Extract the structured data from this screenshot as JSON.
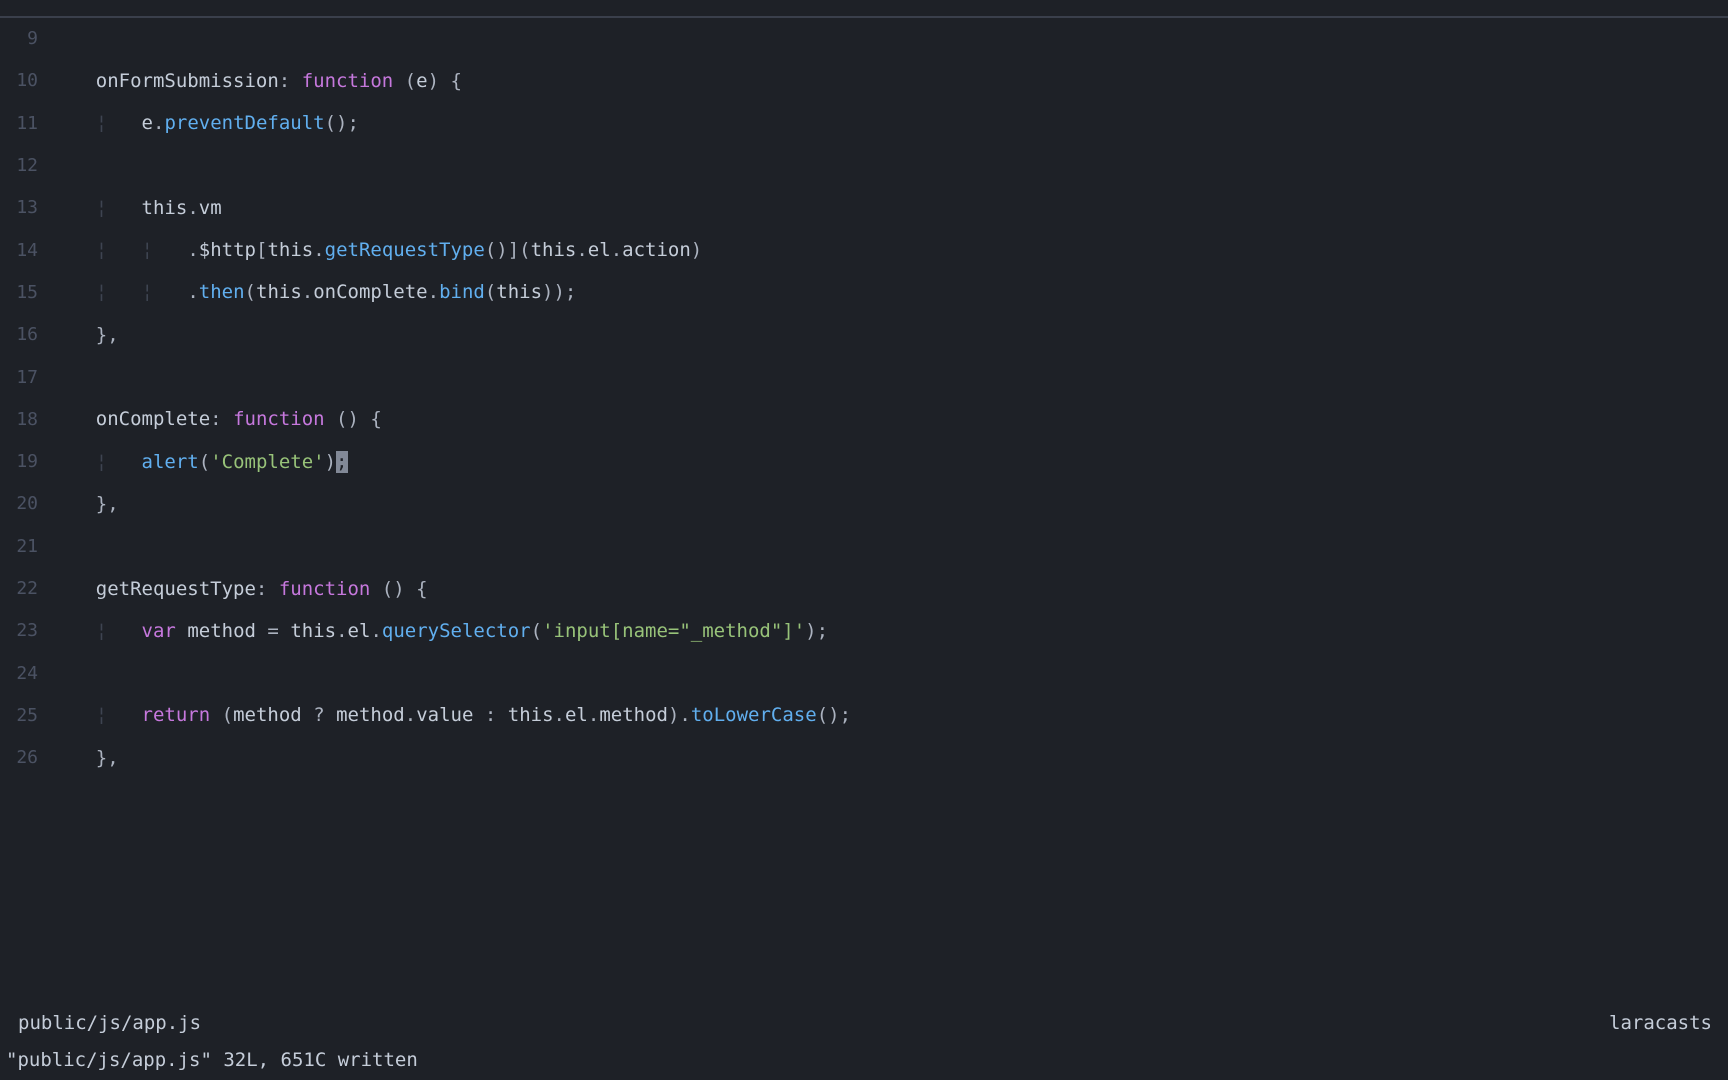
{
  "lines": [
    {
      "num": "9",
      "tokens": []
    },
    {
      "num": "10",
      "tokens": [
        {
          "t": "    ",
          "c": "plain"
        },
        {
          "t": "onFormSubmission",
          "c": "plain"
        },
        {
          "t": ":",
          "c": "punctuation"
        },
        {
          "t": " ",
          "c": "plain"
        },
        {
          "t": "function",
          "c": "keyword"
        },
        {
          "t": " ",
          "c": "plain"
        },
        {
          "t": "(",
          "c": "punctuation"
        },
        {
          "t": "e",
          "c": "plain"
        },
        {
          "t": ")",
          "c": "punctuation"
        },
        {
          "t": " ",
          "c": "plain"
        },
        {
          "t": "{",
          "c": "punctuation"
        }
      ]
    },
    {
      "num": "11",
      "tokens": [
        {
          "t": "    ",
          "c": "plain"
        },
        {
          "t": "¦",
          "c": "indent-guide"
        },
        {
          "t": "   ",
          "c": "plain"
        },
        {
          "t": "e",
          "c": "plain"
        },
        {
          "t": ".",
          "c": "punctuation"
        },
        {
          "t": "preventDefault",
          "c": "function-name"
        },
        {
          "t": "();",
          "c": "punctuation"
        }
      ]
    },
    {
      "num": "12",
      "tokens": []
    },
    {
      "num": "13",
      "tokens": [
        {
          "t": "    ",
          "c": "plain"
        },
        {
          "t": "¦",
          "c": "indent-guide"
        },
        {
          "t": "   ",
          "c": "plain"
        },
        {
          "t": "this",
          "c": "plain"
        },
        {
          "t": ".",
          "c": "punctuation"
        },
        {
          "t": "vm",
          "c": "plain"
        }
      ]
    },
    {
      "num": "14",
      "tokens": [
        {
          "t": "    ",
          "c": "plain"
        },
        {
          "t": "¦",
          "c": "indent-guide"
        },
        {
          "t": "   ",
          "c": "plain"
        },
        {
          "t": "¦",
          "c": "indent-guide"
        },
        {
          "t": "   ",
          "c": "plain"
        },
        {
          "t": ".",
          "c": "punctuation"
        },
        {
          "t": "$http",
          "c": "plain"
        },
        {
          "t": "[",
          "c": "punctuation"
        },
        {
          "t": "this",
          "c": "plain"
        },
        {
          "t": ".",
          "c": "punctuation"
        },
        {
          "t": "getRequestType",
          "c": "function-name"
        },
        {
          "t": "()](",
          "c": "punctuation"
        },
        {
          "t": "this",
          "c": "plain"
        },
        {
          "t": ".",
          "c": "punctuation"
        },
        {
          "t": "el",
          "c": "plain"
        },
        {
          "t": ".",
          "c": "punctuation"
        },
        {
          "t": "action",
          "c": "plain"
        },
        {
          "t": ")",
          "c": "punctuation"
        }
      ]
    },
    {
      "num": "15",
      "tokens": [
        {
          "t": "    ",
          "c": "plain"
        },
        {
          "t": "¦",
          "c": "indent-guide"
        },
        {
          "t": "   ",
          "c": "plain"
        },
        {
          "t": "¦",
          "c": "indent-guide"
        },
        {
          "t": "   ",
          "c": "plain"
        },
        {
          "t": ".",
          "c": "punctuation"
        },
        {
          "t": "then",
          "c": "function-name"
        },
        {
          "t": "(",
          "c": "punctuation"
        },
        {
          "t": "this",
          "c": "plain"
        },
        {
          "t": ".",
          "c": "punctuation"
        },
        {
          "t": "onComplete",
          "c": "plain"
        },
        {
          "t": ".",
          "c": "punctuation"
        },
        {
          "t": "bind",
          "c": "function-name"
        },
        {
          "t": "(",
          "c": "punctuation"
        },
        {
          "t": "this",
          "c": "plain"
        },
        {
          "t": "));",
          "c": "punctuation"
        }
      ]
    },
    {
      "num": "16",
      "tokens": [
        {
          "t": "    ",
          "c": "plain"
        },
        {
          "t": "},",
          "c": "punctuation"
        }
      ]
    },
    {
      "num": "17",
      "tokens": []
    },
    {
      "num": "18",
      "tokens": [
        {
          "t": "    ",
          "c": "plain"
        },
        {
          "t": "onComplete",
          "c": "plain"
        },
        {
          "t": ":",
          "c": "punctuation"
        },
        {
          "t": " ",
          "c": "plain"
        },
        {
          "t": "function",
          "c": "keyword"
        },
        {
          "t": " ",
          "c": "plain"
        },
        {
          "t": "()",
          "c": "punctuation"
        },
        {
          "t": " ",
          "c": "plain"
        },
        {
          "t": "{",
          "c": "punctuation"
        }
      ]
    },
    {
      "num": "19",
      "tokens": [
        {
          "t": "    ",
          "c": "plain"
        },
        {
          "t": "¦",
          "c": "indent-guide"
        },
        {
          "t": "   ",
          "c": "plain"
        },
        {
          "t": "alert",
          "c": "function-name"
        },
        {
          "t": "(",
          "c": "punctuation"
        },
        {
          "t": "'Complete'",
          "c": "string"
        },
        {
          "t": ")",
          "c": "punctuation"
        },
        {
          "t": ";",
          "c": "cursor"
        }
      ]
    },
    {
      "num": "20",
      "tokens": [
        {
          "t": "    ",
          "c": "plain"
        },
        {
          "t": "},",
          "c": "punctuation"
        }
      ]
    },
    {
      "num": "21",
      "tokens": []
    },
    {
      "num": "22",
      "tokens": [
        {
          "t": "    ",
          "c": "plain"
        },
        {
          "t": "getRequestType",
          "c": "plain"
        },
        {
          "t": ":",
          "c": "punctuation"
        },
        {
          "t": " ",
          "c": "plain"
        },
        {
          "t": "function",
          "c": "keyword"
        },
        {
          "t": " ",
          "c": "plain"
        },
        {
          "t": "()",
          "c": "punctuation"
        },
        {
          "t": " ",
          "c": "plain"
        },
        {
          "t": "{",
          "c": "punctuation"
        }
      ]
    },
    {
      "num": "23",
      "tokens": [
        {
          "t": "    ",
          "c": "plain"
        },
        {
          "t": "¦",
          "c": "indent-guide"
        },
        {
          "t": "   ",
          "c": "plain"
        },
        {
          "t": "var",
          "c": "keyword"
        },
        {
          "t": " ",
          "c": "plain"
        },
        {
          "t": "method",
          "c": "plain"
        },
        {
          "t": " ",
          "c": "plain"
        },
        {
          "t": "=",
          "c": "operator"
        },
        {
          "t": " ",
          "c": "plain"
        },
        {
          "t": "this",
          "c": "plain"
        },
        {
          "t": ".",
          "c": "punctuation"
        },
        {
          "t": "el",
          "c": "plain"
        },
        {
          "t": ".",
          "c": "punctuation"
        },
        {
          "t": "querySelector",
          "c": "function-name"
        },
        {
          "t": "(",
          "c": "punctuation"
        },
        {
          "t": "'input[name=\"_method\"]'",
          "c": "string"
        },
        {
          "t": ");",
          "c": "punctuation"
        }
      ]
    },
    {
      "num": "24",
      "tokens": []
    },
    {
      "num": "25",
      "tokens": [
        {
          "t": "    ",
          "c": "plain"
        },
        {
          "t": "¦",
          "c": "indent-guide"
        },
        {
          "t": "   ",
          "c": "plain"
        },
        {
          "t": "return",
          "c": "keyword"
        },
        {
          "t": " ",
          "c": "plain"
        },
        {
          "t": "(",
          "c": "punctuation"
        },
        {
          "t": "method",
          "c": "plain"
        },
        {
          "t": " ",
          "c": "plain"
        },
        {
          "t": "?",
          "c": "operator"
        },
        {
          "t": " ",
          "c": "plain"
        },
        {
          "t": "method",
          "c": "plain"
        },
        {
          "t": ".",
          "c": "punctuation"
        },
        {
          "t": "value",
          "c": "plain"
        },
        {
          "t": " ",
          "c": "plain"
        },
        {
          "t": ":",
          "c": "operator"
        },
        {
          "t": " ",
          "c": "plain"
        },
        {
          "t": "this",
          "c": "plain"
        },
        {
          "t": ".",
          "c": "punctuation"
        },
        {
          "t": "el",
          "c": "plain"
        },
        {
          "t": ".",
          "c": "punctuation"
        },
        {
          "t": "method",
          "c": "plain"
        },
        {
          "t": ").",
          "c": "punctuation"
        },
        {
          "t": "toLowerCase",
          "c": "function-name"
        },
        {
          "t": "();",
          "c": "punctuation"
        }
      ]
    },
    {
      "num": "26",
      "tokens": [
        {
          "t": "    ",
          "c": "plain"
        },
        {
          "t": "},",
          "c": "punctuation"
        }
      ]
    }
  ],
  "status": {
    "left": "public/js/app.js",
    "right": "laracasts"
  },
  "commandline": "\"public/js/app.js\" 32L, 651C written"
}
